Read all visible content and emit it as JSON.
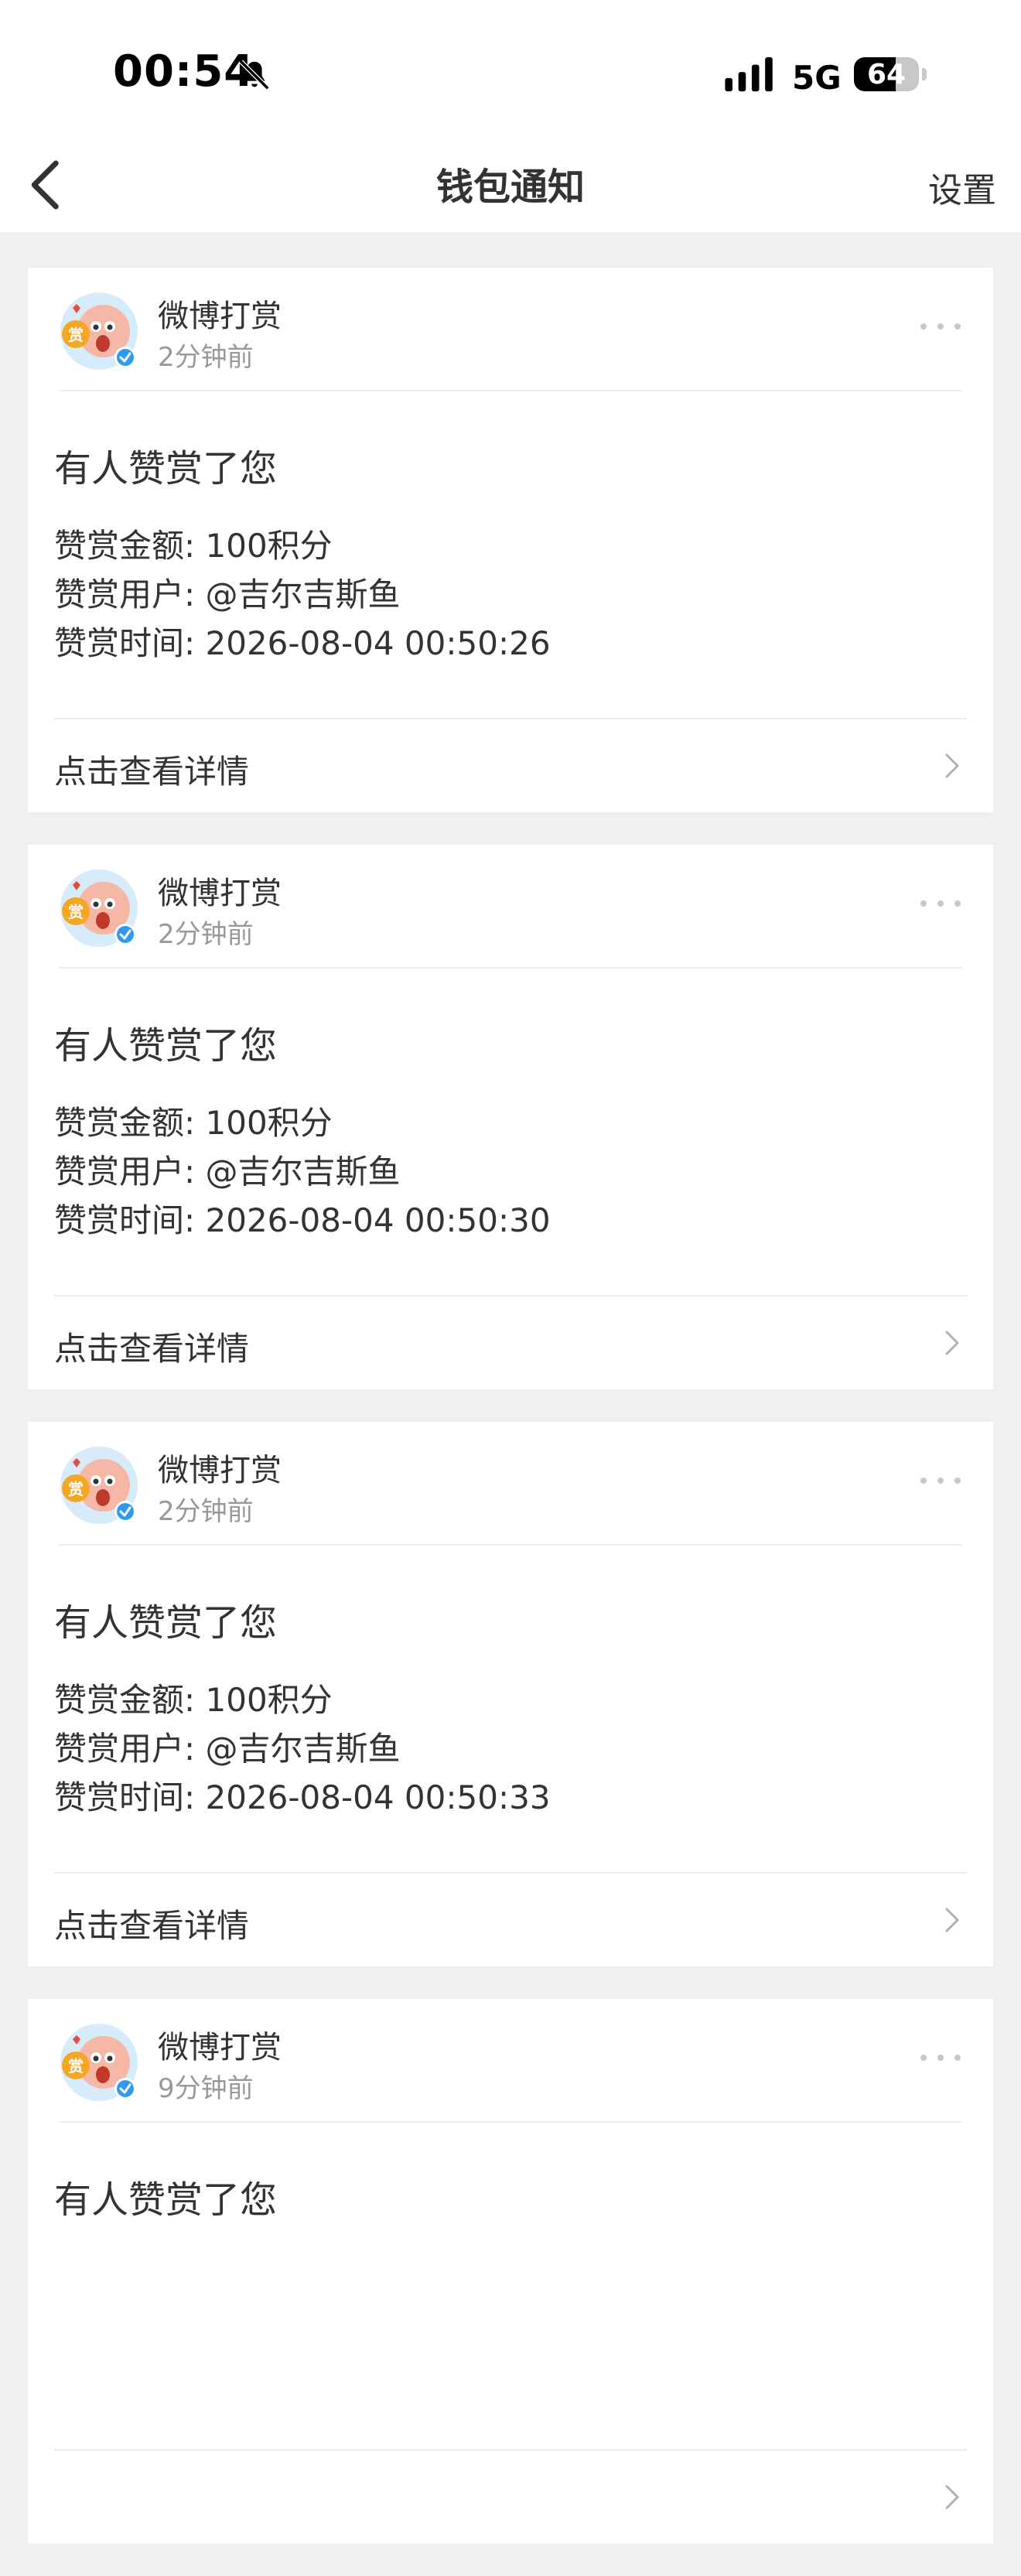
{
  "status_bar": {
    "time": "00:54",
    "bell_icon": "bell-slash-icon",
    "signal_icon": "signal-bars-icon",
    "network": "5G",
    "battery": "64",
    "battery_level": 0.64
  },
  "nav": {
    "back_icon": "chevron-left-icon",
    "title": "钱包通知",
    "settings_label": "设置"
  },
  "colors": {
    "background": "#f0f0f0",
    "card": "#ffffff",
    "text": "#333333",
    "muted": "#999999",
    "verified_badge": "#2f9bf0",
    "reward_badge": "#f5a623"
  },
  "notifications": [
    {
      "sender": "微博打赏",
      "time_ago": "2分钟前",
      "title": "有人赞赏了您",
      "amount_line": "赞赏金额: 100积分",
      "user_line": "赞赏用户: @吉尔吉斯鱼",
      "time_line": "赞赏时间: 2026-08-04 00:50:26",
      "detail_label": "点击查看详情"
    },
    {
      "sender": "微博打赏",
      "time_ago": "2分钟前",
      "title": "有人赞赏了您",
      "amount_line": "赞赏金额: 100积分",
      "user_line": "赞赏用户: @吉尔吉斯鱼",
      "time_line": "赞赏时间: 2026-08-04 00:50:30",
      "detail_label": "点击查看详情"
    },
    {
      "sender": "微博打赏",
      "time_ago": "2分钟前",
      "title": "有人赞赏了您",
      "amount_line": "赞赏金额: 100积分",
      "user_line": "赞赏用户: @吉尔吉斯鱼",
      "time_line": "赞赏时间: 2026-08-04 00:50:33",
      "detail_label": "点击查看详情"
    },
    {
      "sender": "微博打赏",
      "time_ago": "9分钟前",
      "title": "有人赞赏了您",
      "amount_line": "",
      "user_line": "",
      "time_line": "",
      "detail_label": ""
    }
  ]
}
